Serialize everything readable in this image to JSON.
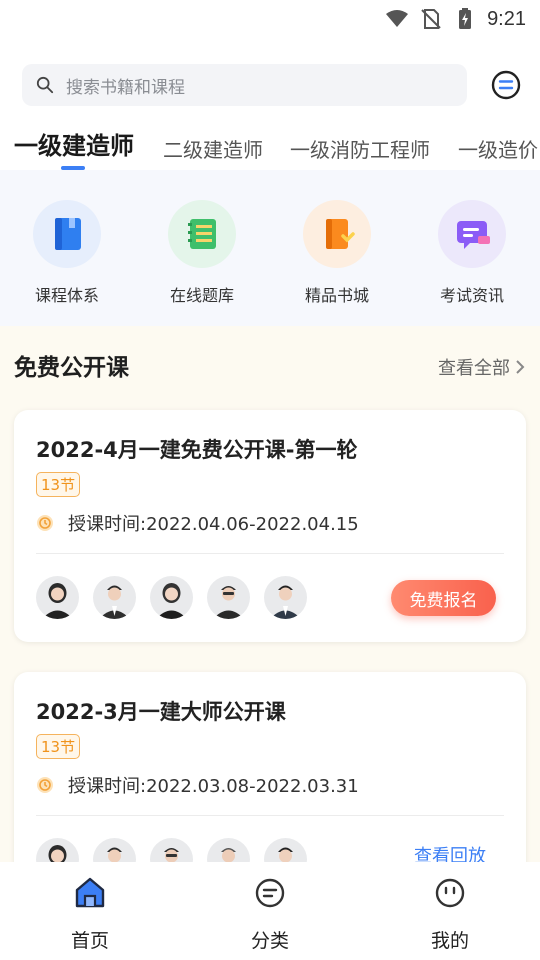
{
  "status_bar": {
    "time": "9:21"
  },
  "search": {
    "placeholder": "搜索书籍和课程"
  },
  "tabs": [
    "一级建造师",
    "二级建造师",
    "一级消防工程师",
    "一级造价"
  ],
  "quick_entries": [
    {
      "label": "课程体系",
      "icon": "book-icon"
    },
    {
      "label": "在线题库",
      "icon": "notebook-icon"
    },
    {
      "label": "精品书城",
      "icon": "bookstore-icon"
    },
    {
      "label": "考试资讯",
      "icon": "chat-icon"
    }
  ],
  "section": {
    "title": "免费公开课",
    "more": "查看全部"
  },
  "courses": [
    {
      "title": "2022-4月一建免费公开课-第一轮",
      "badge": "13节",
      "time_label": "授课时间:",
      "time_range": "2022.04.06-2022.04.15",
      "action": "免费报名"
    },
    {
      "title": "2022-3月一建大师公开课",
      "badge": "13节",
      "time_label": "授课时间:",
      "time_range": "2022.03.08-2022.03.31",
      "action": "查看回放"
    }
  ],
  "bottom_nav": [
    {
      "label": "首页",
      "icon": "home-icon"
    },
    {
      "label": "分类",
      "icon": "category-icon"
    },
    {
      "label": "我的",
      "icon": "profile-icon"
    }
  ],
  "colors": {
    "accent": "#3c7ff5",
    "cta": "#f9614d",
    "badge": "#f0931c"
  }
}
